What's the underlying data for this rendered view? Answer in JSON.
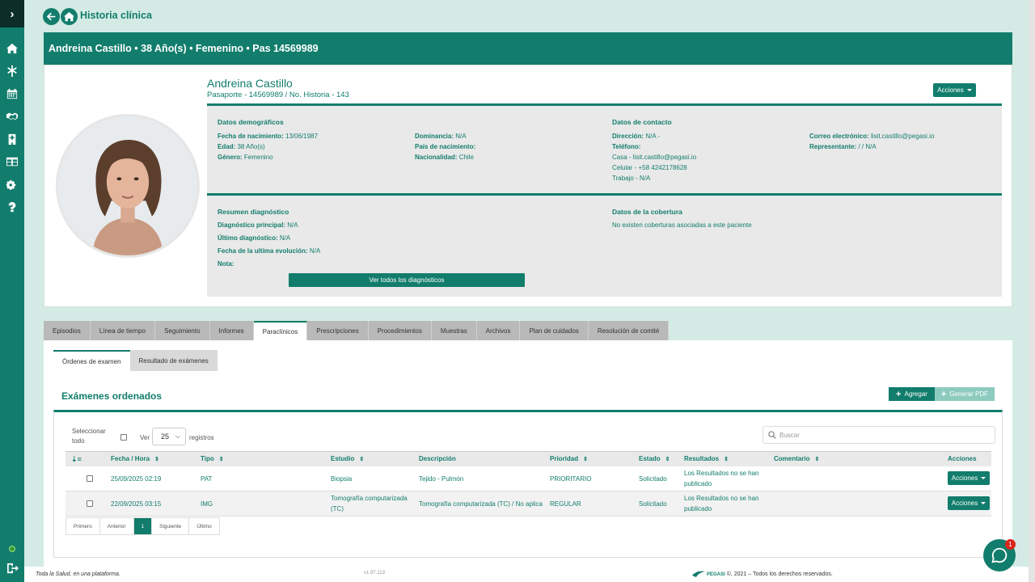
{
  "page": {
    "title": "Historia clínica"
  },
  "patient_header": "Andreina Castillo • 38 Año(s) • Femenino • Pas 14569989",
  "profile": {
    "name": "Andreina Castillo",
    "subtitle": "Pasaporte - 14569989 / No. Historia - 143",
    "actions_label": "Acciones"
  },
  "demographics": {
    "title": "Datos demográficos",
    "birth_label": "Fecha de nacimiento:",
    "birth_value": "13/06/1987",
    "age_label": "Edad:",
    "age_value": "38 Año(s)",
    "gender_label": "Género:",
    "gender_value": "Femenino",
    "dominance_label": "Dominancia:",
    "dominance_value": "N/A",
    "country_label": "País de nacimiento:",
    "country_value": "",
    "nationality_label": "Nacionalidad:",
    "nationality_value": "Chile"
  },
  "contact": {
    "title": "Datos de contacto",
    "address_label": "Dirección:",
    "address_value": "N/A -",
    "phone_label": "Teléfono:",
    "phone_home": "Casa - lisit.castillo@pegasi.io",
    "phone_mobile": "Celular - +58 4242178628",
    "phone_work": "Trabajo - N/A",
    "email_label": "Correo electrónico:",
    "email_value": "lisit.castillo@pegasi.io",
    "rep_label": "Representante:",
    "rep_value": "/ / N/A"
  },
  "diagnosis": {
    "title": "Resumen diagnóstico",
    "main_label": "Diagnóstico principal:",
    "main_value": "N/A",
    "last_label": "Último diagnóstico:",
    "last_value": "N/A",
    "evo_label": "Fecha de la ultima evolución:",
    "evo_value": "N/A",
    "note_label": "Nota:",
    "button": "Ver todos los diagnósticos"
  },
  "coverage": {
    "title": "Datos de la cobertura",
    "text": "No existen coberturas asociadas a este paciente"
  },
  "tabs": [
    "Episodios",
    "Línea de tiempo",
    "Seguimiento",
    "Informes",
    "Paraclínicos",
    "Prescripciones",
    "Procedimientos",
    "Muestras",
    "Archivos",
    "Plan de cuidados",
    "Resolución de comité"
  ],
  "subtabs": [
    "Órdenes de examen",
    "Resultado de exámenes"
  ],
  "exams": {
    "title": "Exámenes ordenados",
    "add_label": "Agregar",
    "pdf_label": "Generar PDF",
    "select_all": "Seleccionar todo",
    "select_all_l1": "Seleccionar",
    "select_all_l2": "todo",
    "show_label": "Ver",
    "page_size": "25",
    "records_label": "registros",
    "search_placeholder": "Buscar",
    "columns": [
      "Fecha / Hora",
      "Tipo",
      "Estudio",
      "Descripción",
      "Prioridad",
      "Estado",
      "Resultados",
      "Comentario",
      "Acciones"
    ],
    "rows": [
      {
        "date": "25/09/2025 02:19",
        "type": "PAT",
        "study": "Biopsia",
        "study2": "",
        "desc": "Tejido - Pulmón",
        "priority": "PRIORITARIO",
        "status": "Solicitado",
        "results": "Los Resultados no se han",
        "results2": "publicado",
        "action": "Acciones"
      },
      {
        "date": "22/09/2025 03:15",
        "type": "IMG",
        "study": "Tomografía computarizada",
        "study2": "(TC)",
        "desc": "Tomografía computarizada (TC) / No aplica",
        "priority": "REGULAR",
        "status": "Solicitado",
        "results": "Los Resultados no se han",
        "results2": "publicado",
        "action": "Acciones"
      }
    ],
    "pager": [
      "Primero",
      "Anterior",
      "1",
      "Siguiente",
      "Último"
    ]
  },
  "footer": {
    "slogan": "Toda la Salud, en una plataforma.",
    "version": "v1.97.113",
    "brand": "PEGASI",
    "copyright": "©, 2021 – Todos los derechos reservados."
  },
  "chat": {
    "badge": "1"
  },
  "icons": [
    "chevron-right-icon",
    "home-icon",
    "asterisk-icon",
    "calendar-icon",
    "handshake-icon",
    "hospital-icon",
    "table-icon",
    "gears-icon",
    "question-icon",
    "logout-icon",
    "arrow-left-icon",
    "search-icon",
    "sort-icon",
    "chat-icon"
  ],
  "colors": {
    "primary": "#127d6c",
    "background": "#d3ebe4",
    "badge": "#d9261c"
  }
}
